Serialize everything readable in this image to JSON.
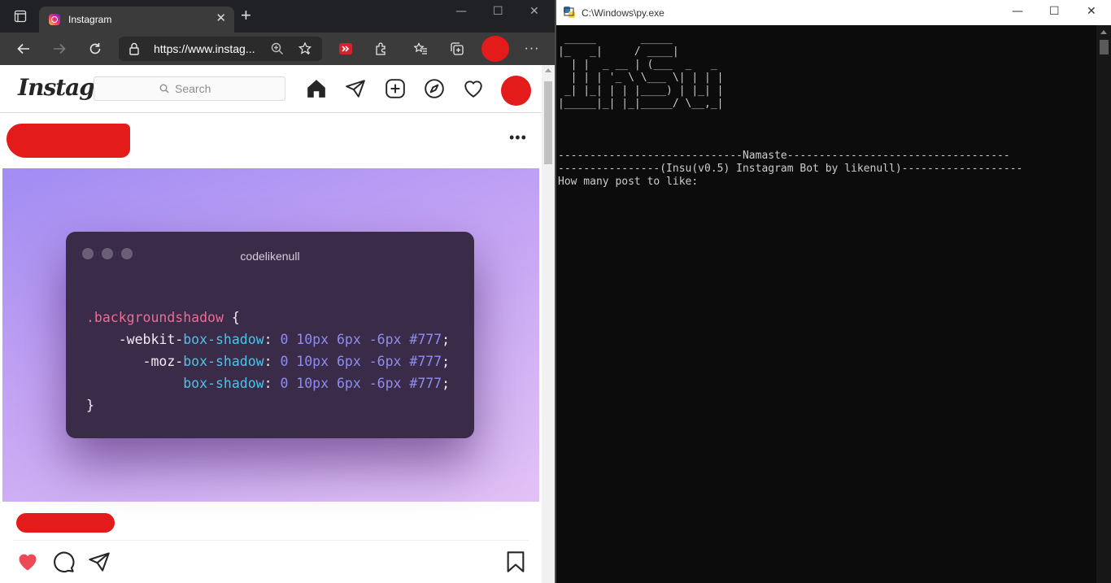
{
  "browser": {
    "tab": {
      "title": "Instagram",
      "favicon": "instagram-icon"
    },
    "address_url": "https://www.instag...",
    "window_controls": {
      "minimize": "—",
      "maximize": "☐",
      "close": "✕"
    },
    "newtab_label": "+",
    "tab_close_label": "✕"
  },
  "instagram": {
    "logo": "Instagram",
    "search_placeholder": "Search",
    "nav_icons": [
      "home-icon",
      "direct-message-icon",
      "new-post-icon",
      "explore-icon",
      "activity-heart-icon"
    ],
    "post": {
      "more_label": "•••",
      "card": {
        "title": "codelikenull",
        "code_lines": [
          {
            "sel": ".backgroundshadow",
            "brace": " {"
          },
          {
            "indent": "    -webkit-",
            "prop": "box-shadow",
            "colon": ": ",
            "val": "0 10px 6px -6px #777",
            "semi": ";"
          },
          {
            "indent": "       -moz-",
            "prop": "box-shadow",
            "colon": ": ",
            "val": "0 10px 6px -6px #777",
            "semi": ";"
          },
          {
            "indent": "            ",
            "prop": "box-shadow",
            "colon": ": ",
            "val": "0 10px 6px -6px #777",
            "semi": ";"
          },
          {
            "close": "}"
          }
        ]
      },
      "actions": [
        "like-heart-icon",
        "comment-icon",
        "share-icon",
        "save-bookmark-icon"
      ],
      "liked": true
    }
  },
  "console": {
    "title": "C:\\Windows\\py.exe",
    "banner": [
      " _____       _____",
      "|_   _|     / ____|",
      "  | |  _ __ | (___  _   _",
      "  | | | '_ \\ \\___ \\| | | |",
      " _| |_| | | |____) | |_| |",
      "|_____|_| |_|_____/ \\__,_|"
    ],
    "line1": "-----------------------------Namaste-----------------------------------",
    "line2": "----------------(Insu(v0.5) Instagram Bot by likenull)-------------------",
    "prompt": "How many post to like:"
  },
  "colors": {
    "redaction": "#e31b1b",
    "like_red": "#ed4956",
    "console_bg": "#0c0c0c",
    "card_bg": "#3a2c48"
  }
}
